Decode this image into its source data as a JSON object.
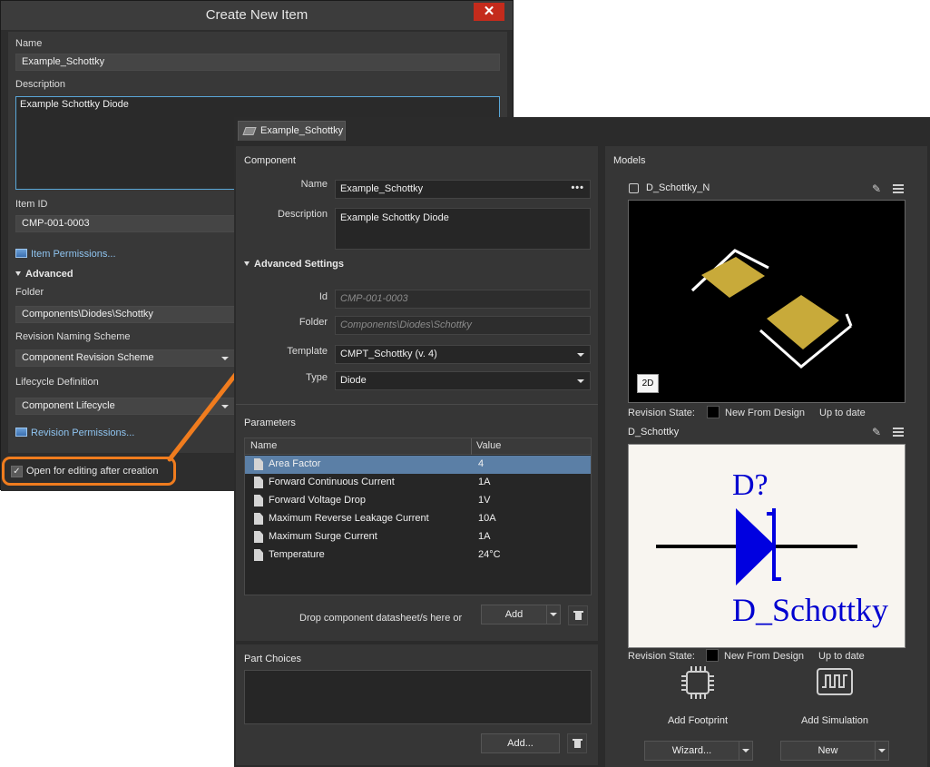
{
  "dialog": {
    "title": "Create New Item",
    "close_label": "✕",
    "name_label": "Name",
    "name_value": "Example_Schottky",
    "description_label": "Description",
    "description_value": "Example Schottky Diode",
    "item_id_label": "Item ID",
    "item_id_value": "CMP-001-0003",
    "item_permissions_link": "Item Permissions...",
    "advanced_label": "Advanced",
    "folder_label": "Folder",
    "folder_value": "Components\\Diodes\\Schottky",
    "revision_naming_label": "Revision Naming Scheme",
    "revision_naming_value": "Component Revision Scheme",
    "lifecycle_label": "Lifecycle Definition",
    "lifecycle_value": "Component Lifecycle",
    "revision_permissions_link": "Revision Permissions...",
    "open_for_editing_label": "Open for editing after creation",
    "open_for_editing_checked": true
  },
  "editor": {
    "tab_label": "Example_Schottky",
    "component": {
      "section_title": "Component",
      "name_label": "Name",
      "name_value": "Example_Schottky",
      "name_more": "•••",
      "description_label": "Description",
      "description_value": "Example Schottky Diode",
      "advanced_settings_label": "Advanced Settings",
      "id_label": "Id",
      "id_value": "CMP-001-0003",
      "folder_label": "Folder",
      "folder_value": "Components\\Diodes\\Schottky",
      "template_label": "Template",
      "template_value": "CMPT_Schottky (v. 4)",
      "type_label": "Type",
      "type_value": "Diode"
    },
    "parameters": {
      "section_title": "Parameters",
      "columns": [
        "Name",
        "Value"
      ],
      "rows": [
        {
          "name": "Area Factor",
          "value": "4",
          "selected": true
        },
        {
          "name": "Forward Continuous Current",
          "value": "1A"
        },
        {
          "name": "Forward Voltage Drop",
          "value": "1V"
        },
        {
          "name": "Maximum Reverse Leakage Current",
          "value": "10A"
        },
        {
          "name": "Maximum Surge Current",
          "value": "1A"
        },
        {
          "name": "Temperature",
          "value": "24°C"
        }
      ],
      "drop_text": "Drop component datasheet/s here or",
      "add_button": "Add"
    },
    "part_choices": {
      "section_title": "Part Choices",
      "add_button": "Add..."
    },
    "models": {
      "section_title": "Models",
      "footprint": {
        "name": "D_Schottky_N",
        "badge": "2D",
        "revision_state_label": "Revision State:",
        "revision_state_value": "New From Design",
        "status": "Up to date"
      },
      "symbol": {
        "name": "D_Schottky",
        "designator": "D?",
        "comment": "D_Schottky",
        "revision_state_label": "Revision State:",
        "revision_state_value": "New From Design",
        "status": "Up to date"
      },
      "add_footprint_label": "Add Footprint",
      "add_simulation_label": "Add Simulation",
      "wizard_button": "Wizard...",
      "new_button": "New"
    }
  },
  "colors": {
    "accent_orange": "#f07c1e",
    "selection_blue": "#5b7fa6",
    "pad_gold": "#c8aa3a",
    "symbol_blue": "#0000d0"
  }
}
